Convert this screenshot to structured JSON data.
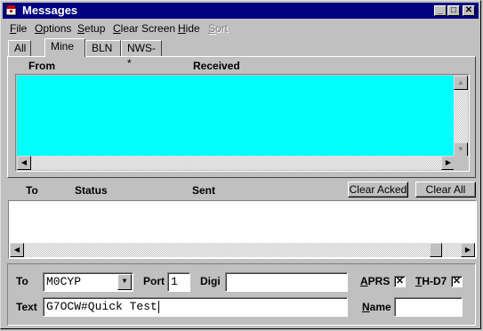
{
  "window": {
    "title": "Messages"
  },
  "menu": {
    "items": [
      {
        "pre": "",
        "ul": "F",
        "post": "ile"
      },
      {
        "pre": "",
        "ul": "O",
        "post": "ptions"
      },
      {
        "pre": "",
        "ul": "S",
        "post": "etup"
      },
      {
        "pre": "",
        "ul": "C",
        "post": "lear Screen"
      },
      {
        "pre": "",
        "ul": "H",
        "post": "ide"
      },
      {
        "pre": "",
        "ul": "S",
        "post": "ort"
      }
    ]
  },
  "tabs": [
    "All",
    "Mine",
    "BLN",
    "NWS-*"
  ],
  "received": {
    "col_from": "From",
    "col_received": "Received"
  },
  "sent": {
    "col_to": "To",
    "col_status": "Status",
    "col_sent": "Sent"
  },
  "buttons": {
    "clear_acked": "Clear Acked",
    "clear_all": "Clear All"
  },
  "form": {
    "to_label": "To",
    "to_value": "M0CYP",
    "port_label": "Port",
    "port_value": "1",
    "digi_label": "Digi",
    "digi_value": "",
    "aprs_label_ul": "A",
    "aprs_label_rest": "PRS",
    "aprs_checked": "✕",
    "thd7_label_ul": "T",
    "thd7_label_rest": "H-D7",
    "thd7_checked": "✕",
    "text_label": "Text",
    "text_value": "G7OCW#Quick Test",
    "name_label_ul": "N",
    "name_label_rest": "ame",
    "name_value": ""
  }
}
